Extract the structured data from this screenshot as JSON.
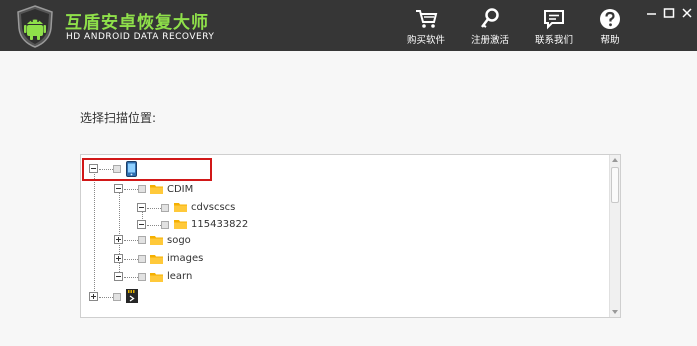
{
  "app": {
    "title": "互盾安卓恢复大师",
    "subtitle": "HD ANDROID DATA RECOVERY",
    "logo_icon": "android-shield-icon",
    "brand_color": "#8fe04a",
    "titlebar_color": "#363636"
  },
  "toolbar": {
    "buy": {
      "label": "购买软件",
      "icon": "cart-icon"
    },
    "register": {
      "label": "注册激活",
      "icon": "key-icon"
    },
    "contact": {
      "label": "联系我们",
      "icon": "chat-icon"
    },
    "help": {
      "label": "帮助",
      "icon": "question-icon"
    }
  },
  "window_controls": [
    "minimize-icon",
    "maximize-icon",
    "close-icon"
  ],
  "scan": {
    "label": "选择扫描位置:"
  },
  "tree": {
    "root_phone": {
      "icon": "phone-icon",
      "expanded": true,
      "label": ""
    },
    "folders": [
      {
        "label": "CDIM",
        "expanded": true
      },
      {
        "label": "cdvscscs",
        "expanded": true
      },
      {
        "label": "115433822",
        "expanded": true
      },
      {
        "label": "sogo",
        "expanded": false
      },
      {
        "label": "images",
        "expanded": false
      },
      {
        "label": "learn",
        "expanded": true
      }
    ],
    "sd_card": {
      "icon": "sd-card-icon",
      "expanded": false,
      "label": ""
    }
  },
  "highlight_color": "#d11818"
}
